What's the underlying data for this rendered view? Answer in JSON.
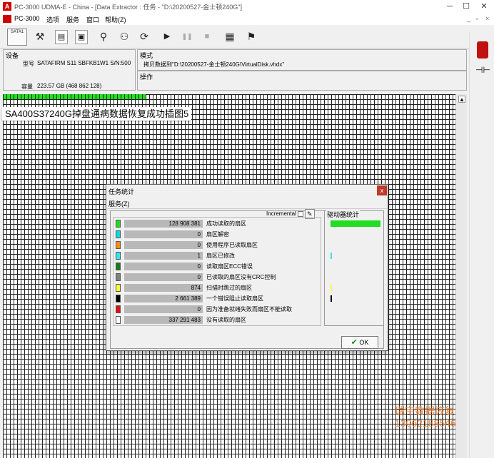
{
  "window": {
    "app_icon_letter": "A",
    "title": "PC-3000 UDMA-E - China - [Data Extractor : 任务 - \"D:\\20200527-金士顿240G\"]",
    "minimize_glyph": "─",
    "maximize_glyph": "☐",
    "close_glyph": "✕"
  },
  "menu": {
    "items": [
      "PC-3000",
      "选项",
      "服务",
      "窗口",
      "帮助(Z)"
    ],
    "mdi_glyphs": [
      "_",
      "▫",
      "×"
    ]
  },
  "toolbar": {
    "sata_label": "SATA1",
    "buttons": [
      "⚒",
      "▤",
      "▣",
      "⚲",
      "⚇",
      "⟳",
      "▶",
      "❚❚",
      "■",
      "▦",
      "⚑"
    ]
  },
  "device_panel": {
    "title": "设备",
    "model_label": "型号",
    "model_value": "SATAFIRM   S11 SBFKB1W1 S/N:500",
    "capacity_label": "容量",
    "capacity_value": "223.57 GB (468 862 128)"
  },
  "mode_panel": {
    "title": "模式",
    "value": "拷贝数据到\"D:\\20200527-金士顿240G\\VirtualDisk.vhdx\""
  },
  "operation_panel": {
    "title": "操作"
  },
  "caption": "SA400S37240G掉盘通病数据恢复成功插图5",
  "dialog": {
    "title": "任务统计",
    "close_glyph": "x",
    "menu_item": "服务(Z)",
    "incremental_label": "Incremental",
    "incremental_icon": "✎",
    "drive_stats_label": "驱动器统计",
    "ok_label": "OK",
    "ok_check": "✔",
    "rows": [
      {
        "color": "#22dd22",
        "value": "128 908 381",
        "label": "成功读取的扇区",
        "fraction": 1.0,
        "drive_mark": "bar"
      },
      {
        "color": "#00dede",
        "value": "0",
        "label": "扇区解密"
      },
      {
        "color": "#ff8c1a",
        "value": "0",
        "label": "使用程序已读取扇区"
      },
      {
        "color": "#33e6f0",
        "value": "1",
        "label": "扇区已修改",
        "drive_mark": "#33e6f0"
      },
      {
        "color": "#1a7a1a",
        "value": "0",
        "label": "读取扇区ECC错误"
      },
      {
        "color": "#808080",
        "value": "0",
        "label": "已读取的扇区没有CRC控制"
      },
      {
        "color": "#ffff33",
        "value": "874",
        "label": "扫描时跳过的扇区",
        "drive_mark": "#ffff33"
      },
      {
        "color": "#000000",
        "value": "2 661 389",
        "label": "一个错误阻止读取扇区",
        "drive_mark": "#000000"
      },
      {
        "color": "#e01010",
        "value": "0",
        "label": "因为准备就绪失败而扇区不能读取"
      },
      {
        "color": "#ffffff",
        "value": "337 291 483",
        "label": "没有读取的扇区"
      }
    ]
  },
  "watermark": {
    "line1": "瑞宇数据恢复",
    "line2": "13062188546"
  }
}
